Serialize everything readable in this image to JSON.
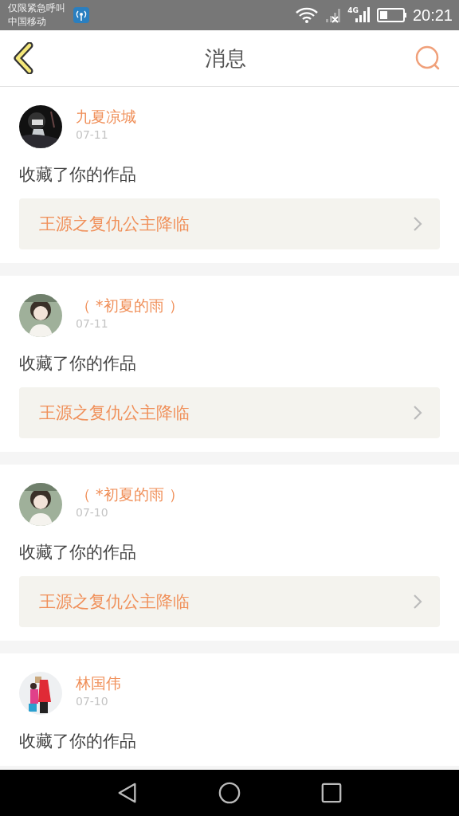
{
  "status_bar": {
    "carrier_notice": "仅限紧急呼叫",
    "carrier": "中国移动",
    "network": "4G",
    "time": "20:21"
  },
  "header": {
    "title": "消息"
  },
  "messages": [
    {
      "name": "九夏凉城",
      "date": "07-11",
      "action": "收藏了你的作品",
      "work": "王源之复仇公主降临"
    },
    {
      "name": "（ *初夏的雨 ）",
      "date": "07-11",
      "action": "收藏了你的作品",
      "work": "王源之复仇公主降临"
    },
    {
      "name": "（ *初夏的雨 ）",
      "date": "07-10",
      "action": "收藏了你的作品",
      "work": "王源之复仇公主降临"
    },
    {
      "name": "林国伟",
      "date": "07-10",
      "action": "收藏了你的作品"
    }
  ]
}
